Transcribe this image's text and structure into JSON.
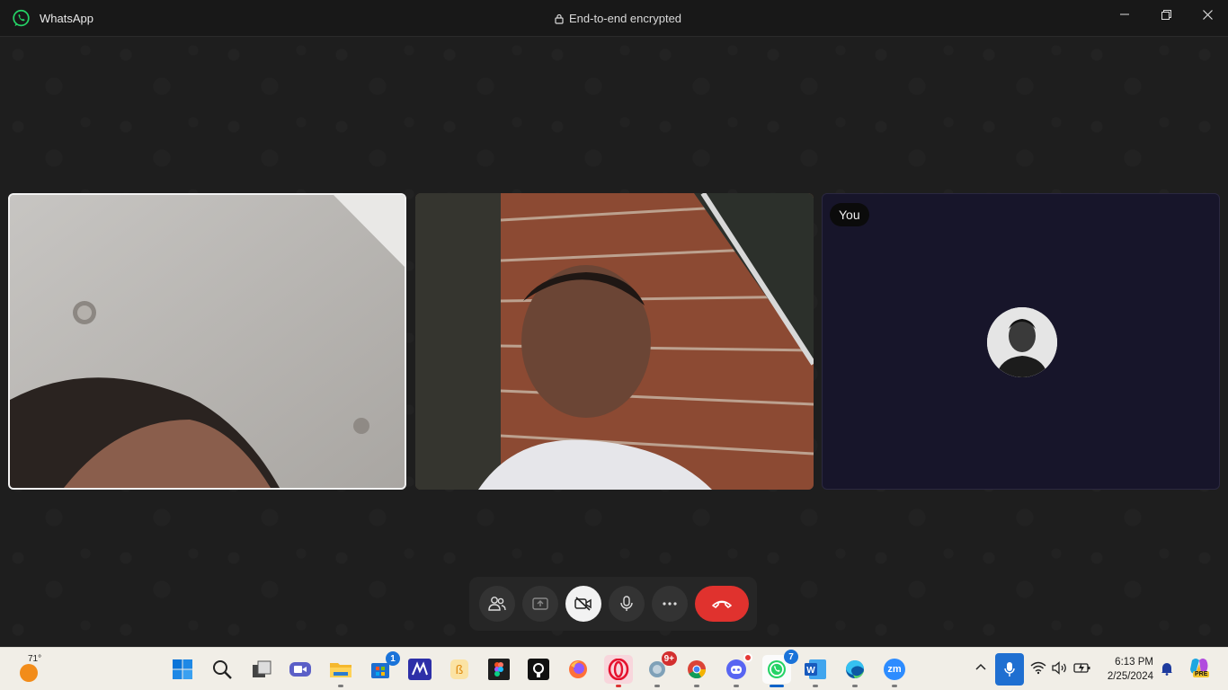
{
  "window": {
    "app_name": "WhatsApp",
    "encryption_text": "End-to-end encrypted",
    "controls": [
      "minimize-icon",
      "restore-icon",
      "close-icon"
    ]
  },
  "call": {
    "participants": [
      {
        "label": "",
        "video": "on",
        "active_speaker": true
      },
      {
        "label": "",
        "video": "on"
      },
      {
        "label": "You",
        "video": "off",
        "avatar": "profile-photo"
      }
    ],
    "buttons": [
      {
        "name": "participants-button",
        "icon": "people-icon"
      },
      {
        "name": "share-screen-button",
        "icon": "share-screen-icon"
      },
      {
        "name": "camera-toggle-button",
        "icon": "video-off-icon",
        "state": "off"
      },
      {
        "name": "mute-button",
        "icon": "microphone-icon"
      },
      {
        "name": "more-options-button",
        "icon": "ellipsis-icon"
      },
      {
        "name": "end-call-button",
        "icon": "phone-hangup-icon"
      }
    ],
    "colors": {
      "end_call": "#e0322e",
      "camera_off_bg": "#f2f2f2",
      "accent": "#25d366"
    }
  },
  "taskbar": {
    "weather": {
      "temp": "71°",
      "icon": "sun-icon"
    },
    "apps": [
      {
        "name": "start",
        "icon": "windows-icon"
      },
      {
        "name": "search",
        "icon": "search-icon"
      },
      {
        "name": "task-view",
        "icon": "task-view-icon"
      },
      {
        "name": "teams-meet",
        "icon": "video-chat-icon"
      },
      {
        "name": "file-explorer",
        "icon": "folder-icon",
        "running": true
      },
      {
        "name": "microsoft-store",
        "icon": "store-icon",
        "badge": "1"
      },
      {
        "name": "app-m",
        "icon": "m-app-icon"
      },
      {
        "name": "app-b",
        "icon": "b-app-icon"
      },
      {
        "name": "figma",
        "icon": "figma-icon"
      },
      {
        "name": "github",
        "icon": "github-icon"
      },
      {
        "name": "firefox",
        "icon": "firefox-icon"
      },
      {
        "name": "opera",
        "icon": "opera-icon",
        "running": true
      },
      {
        "name": "app-teal",
        "icon": "teal-app-icon",
        "badge": "9+",
        "running": true
      },
      {
        "name": "chrome",
        "icon": "chrome-icon",
        "running": true
      },
      {
        "name": "discord",
        "icon": "discord-icon",
        "badge": "",
        "running": true
      },
      {
        "name": "whatsapp",
        "icon": "whatsapp-icon",
        "badge": "7",
        "active": true
      },
      {
        "name": "word",
        "icon": "word-icon",
        "running": true
      },
      {
        "name": "edge",
        "icon": "edge-icon",
        "running": true
      },
      {
        "name": "zoom",
        "icon": "zoom-icon",
        "label": "zm",
        "running": true
      }
    ],
    "tray": [
      "chevron-up-icon",
      "microphone-icon",
      "wifi-icon",
      "volume-icon",
      "battery-icon"
    ],
    "clock": {
      "time": "6:13 PM",
      "date": "2/25/2024"
    },
    "notification_icon": "bell-icon",
    "copilot_icon": "copilot-icon",
    "copilot_label": "PRE"
  }
}
